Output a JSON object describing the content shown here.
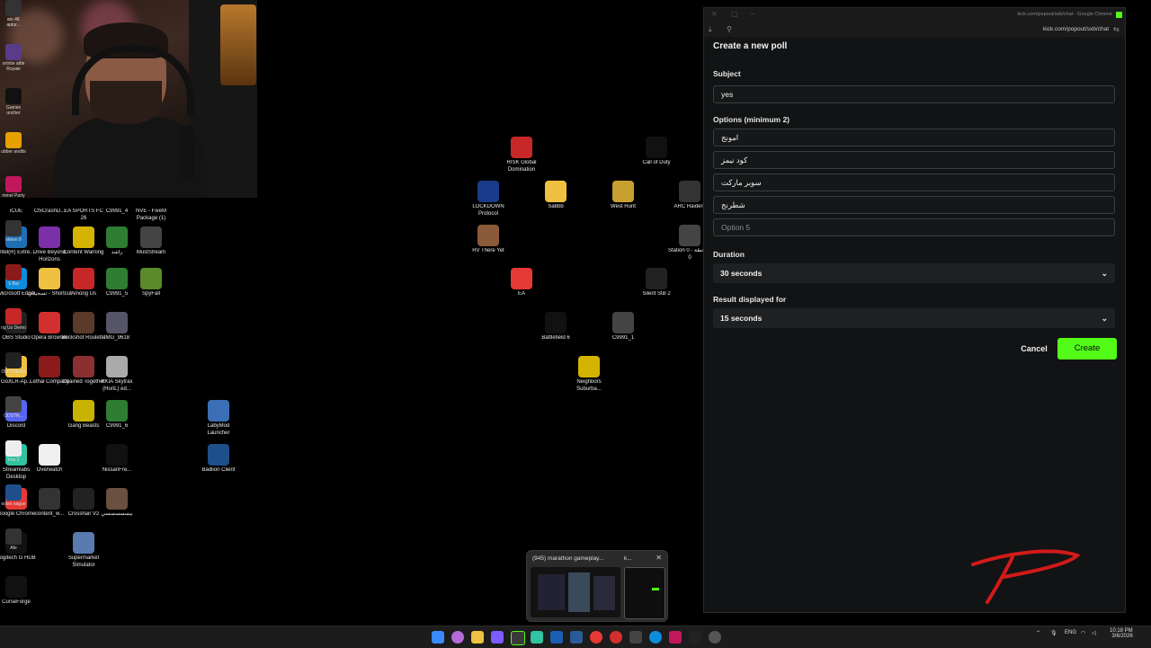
{
  "webcam": {
    "description_colors": [
      "#2b1a14",
      "#1b1411"
    ]
  },
  "desktop_icons_left": [
    {
      "label": "iCUE",
      "color": "#333"
    },
    {
      "label": "CfxCrashD...",
      "color": "#222"
    },
    {
      "label": "EA SPORTS FC 26",
      "color": "#1a2a50"
    },
    {
      "label": "C9991_4",
      "color": "#1a1a1a"
    },
    {
      "label": "NVE - FiveM Package (1)",
      "color": "#1a1a1a"
    },
    {
      "label": "Intel(R) Extre...",
      "color": "#1f6fb5"
    },
    {
      "label": "Drive Beyond Horizons",
      "color": "#7b2fa8"
    },
    {
      "label": "Content Warning",
      "color": "#d4b400"
    },
    {
      "label": "راشد",
      "color": "#2e7d32"
    },
    {
      "label": "MustStream",
      "color": "#444"
    },
    {
      "label": "Microsoft Edge",
      "color": "#0c8ddc"
    },
    {
      "label": "تسجيلات - Shortcut",
      "color": "#f0c040"
    },
    {
      "label": "Among Us",
      "color": "#c62828"
    },
    {
      "label": "C9991_5",
      "color": "#2e7d32"
    },
    {
      "label": "SpyFall",
      "color": "#5a8a2a"
    },
    {
      "label": "OBS Studio",
      "color": "#222"
    },
    {
      "label": "Opera Browser",
      "color": "#d32f2f"
    },
    {
      "label": "Buckshot Roulette",
      "color": "#5a3a2a"
    },
    {
      "label": "IMG_9618",
      "color": "#556"
    },
    {
      "label": "GoXLR-Ap...",
      "color": "#f0c040"
    },
    {
      "label": "Lethal Company",
      "color": "#8b1a1a"
    },
    {
      "label": "Chained Together",
      "color": "#8a3030"
    },
    {
      "label": "KKIA Skytrax (HoriL) ed...",
      "color": "#aaa"
    },
    {
      "label": "Discord",
      "color": "#5865f2"
    },
    {
      "label": "Gang Beasts",
      "color": "#c8b400"
    },
    {
      "label": "C9991_6",
      "color": "#2e7d32"
    },
    {
      "label": "LabyMod Launcher",
      "color": "#3a6fb5"
    },
    {
      "label": "Streamlabs Desktop",
      "color": "#31c3a2"
    },
    {
      "label": "Overwatch",
      "color": "#f0f0f0"
    },
    {
      "label": "NissanFre...",
      "color": "#111"
    },
    {
      "label": "Badlion Client",
      "color": "#1f4f8a"
    },
    {
      "label": "Google Chrome",
      "color": "#e53935"
    },
    {
      "label": "content_w...",
      "color": "#333"
    },
    {
      "label": "Crosshair V2",
      "color": "#222"
    },
    {
      "label": "بيسسسسسي",
      "color": "#6a5040"
    },
    {
      "label": "Logitech G HUB",
      "color": "#111"
    },
    {
      "label": "Supermarket Simulator",
      "color": "#5a7ab0"
    },
    {
      "label": "CurseForge",
      "color": "#111"
    }
  ],
  "desktop_icons_center": [
    {
      "label": "RISK Global Domination",
      "color": "#c62828"
    },
    {
      "label": "Call of Duty",
      "color": "#111"
    },
    {
      "label": "LOCKDOWN Protocol",
      "color": "#1a3a8a"
    },
    {
      "label": "Sabbb",
      "color": "#f0c040"
    },
    {
      "label": "West Hunt",
      "color": "#c8a030"
    },
    {
      "label": "ARC Raiders",
      "color": "#333"
    },
    {
      "label": "RV There Yet",
      "color": "#8a5a3a"
    },
    {
      "label": "Station 0 - المحطة 0",
      "color": "#444"
    },
    {
      "label": "EA",
      "color": "#e53935"
    },
    {
      "label": "Silent Still 2",
      "color": "#222"
    },
    {
      "label": "Battlefield 6",
      "color": "#111"
    },
    {
      "label": "C9991_1",
      "color": "#444"
    },
    {
      "label": "Neighbors Suburba...",
      "color": "#d4b400"
    }
  ],
  "preview": {
    "title": "(945) marathon gameplay...",
    "title2": "k..."
  },
  "chrome": {
    "title": "kick.com/popout/sxb/chat - Google Chrome",
    "url": "kick.com/popout/sxb/chat"
  },
  "poll": {
    "heading": "Create a new poll",
    "subject_label": "Subject",
    "subject_value": "yes",
    "options_label": "Options (minimum 2)",
    "options": [
      "امونج",
      "كود نيمز",
      "سوبر ماركت",
      "شطرنج"
    ],
    "option5_placeholder": "Option 5",
    "duration_label": "Duration",
    "duration_value": "30 seconds",
    "result_label": "Result displayed for",
    "result_value": "15 seconds",
    "cancel": "Cancel",
    "create": "Create",
    "accent": "#53fc18"
  },
  "right_strip": [
    {
      "label": "ato 4K aptur..."
    },
    {
      "label": "ortnite attle Royale"
    },
    {
      "label": "Games uncher"
    },
    {
      "label": "ubber andits"
    },
    {
      "label": "mmel Party"
    },
    {
      "label": "ekken 8"
    },
    {
      "label": "'s Bar"
    },
    {
      "label": "ng Us Demo"
    },
    {
      "label": "ON'T REAM"
    },
    {
      "label": "ODSTR..."
    },
    {
      "label": "rma 3"
    },
    {
      "label": "ocket eague"
    },
    {
      "label": "Afe"
    }
  ],
  "taskbar": {
    "lang": "ENG",
    "time": "10:18 PM",
    "date": "3/6/2026"
  }
}
